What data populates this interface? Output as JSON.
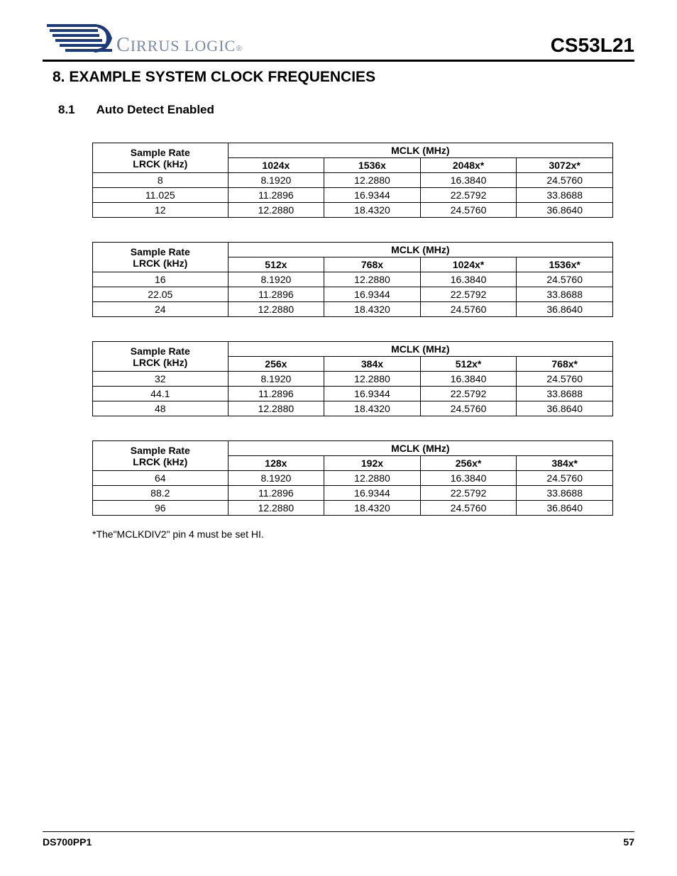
{
  "header": {
    "company": "CIRRUS LOGIC",
    "doc_number": "CS53L21"
  },
  "section": {
    "number": "8.",
    "title": "EXAMPLE SYSTEM CLOCK FREQUENCIES"
  },
  "subsection": {
    "number": "8.1",
    "title": "Auto Detect Enabled"
  },
  "common": {
    "sample_rate_heading_line1": "Sample Rate",
    "sample_rate_heading_line2": "LRCK (kHz)",
    "mclk_heading": "MCLK (MHz)"
  },
  "tables": [
    {
      "multipliers": [
        "1024x",
        "1536x",
        "2048x*",
        "3072x*"
      ],
      "rows": [
        {
          "rate": "8",
          "vals": [
            "8.1920",
            "12.2880",
            "16.3840",
            "24.5760"
          ]
        },
        {
          "rate": "11.025",
          "vals": [
            "11.2896",
            "16.9344",
            "22.5792",
            "33.8688"
          ]
        },
        {
          "rate": "12",
          "vals": [
            "12.2880",
            "18.4320",
            "24.5760",
            "36.8640"
          ]
        }
      ]
    },
    {
      "multipliers": [
        "512x",
        "768x",
        "1024x*",
        "1536x*"
      ],
      "rows": [
        {
          "rate": "16",
          "vals": [
            "8.1920",
            "12.2880",
            "16.3840",
            "24.5760"
          ]
        },
        {
          "rate": "22.05",
          "vals": [
            "11.2896",
            "16.9344",
            "22.5792",
            "33.8688"
          ]
        },
        {
          "rate": "24",
          "vals": [
            "12.2880",
            "18.4320",
            "24.5760",
            "36.8640"
          ]
        }
      ]
    },
    {
      "multipliers": [
        "256x",
        "384x",
        "512x*",
        "768x*"
      ],
      "rows": [
        {
          "rate": "32",
          "vals": [
            "8.1920",
            "12.2880",
            "16.3840",
            "24.5760"
          ]
        },
        {
          "rate": "44.1",
          "vals": [
            "11.2896",
            "16.9344",
            "22.5792",
            "33.8688"
          ]
        },
        {
          "rate": "48",
          "vals": [
            "12.2880",
            "18.4320",
            "24.5760",
            "36.8640"
          ]
        }
      ]
    },
    {
      "multipliers": [
        "128x",
        "192x",
        "256x*",
        "384x*"
      ],
      "rows": [
        {
          "rate": "64",
          "vals": [
            "8.1920",
            "12.2880",
            "16.3840",
            "24.5760"
          ]
        },
        {
          "rate": "88.2",
          "vals": [
            "11.2896",
            "16.9344",
            "22.5792",
            "33.8688"
          ]
        },
        {
          "rate": "96",
          "vals": [
            "12.2880",
            "18.4320",
            "24.5760",
            "36.8640"
          ]
        }
      ]
    }
  ],
  "footnote": "*The\"MCLKDIV2\" pin 4 must be set HI.",
  "footer": {
    "left": "DS700PP1",
    "right": "57"
  }
}
